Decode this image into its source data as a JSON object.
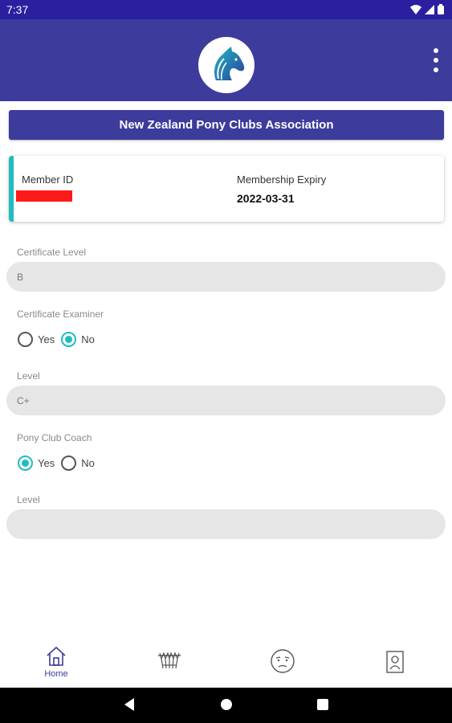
{
  "status_bar": {
    "time": "7:37"
  },
  "app_bar": {
    "logo_icon": "horse-head-logo-icon",
    "menu_icon": "more-vert-icon"
  },
  "banner": {
    "title": "New Zealand Pony Clubs Association"
  },
  "member": {
    "id_label": "Member ID",
    "expiry_label": "Membership Expiry",
    "expiry_value": "2022-03-31"
  },
  "form": {
    "certificate_level": {
      "label": "Certificate Level",
      "value": "B"
    },
    "certificate_examiner": {
      "label": "Certificate Examiner",
      "yes": "Yes",
      "no": "No",
      "selected": "No"
    },
    "examiner_level": {
      "label": "Level",
      "value": "C+"
    },
    "pony_club_coach": {
      "label": "Pony Club Coach",
      "yes": "Yes",
      "no": "No",
      "selected": "Yes"
    },
    "coach_level": {
      "label": "Level",
      "value": ""
    }
  },
  "bottom_nav": {
    "items": [
      {
        "icon": "home-icon",
        "label": "Home",
        "active": true
      },
      {
        "icon": "trophy-icon",
        "label": ""
      },
      {
        "icon": "face-icon",
        "label": ""
      },
      {
        "icon": "member-card-icon",
        "label": ""
      }
    ]
  },
  "colors": {
    "primary": "#3d3b9c",
    "status_bar": "#2b1fa0",
    "accent": "#1fbcc1",
    "redaction": "#ff1a1a"
  }
}
